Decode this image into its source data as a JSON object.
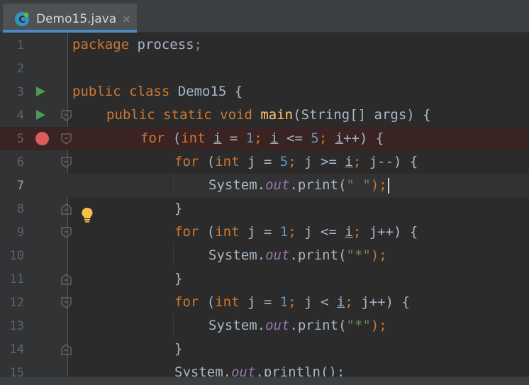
{
  "tab": {
    "icon": "java-class-icon",
    "label": "Demo15.java",
    "close_glyph": "×"
  },
  "editor": {
    "current_line": 7,
    "breakpoint_line": 5,
    "lines": [
      {
        "n": "1"
      },
      {
        "n": "2"
      },
      {
        "n": "3"
      },
      {
        "n": "4"
      },
      {
        "n": "5"
      },
      {
        "n": "6"
      },
      {
        "n": "7"
      },
      {
        "n": "8"
      },
      {
        "n": "9"
      },
      {
        "n": "10"
      },
      {
        "n": "11"
      },
      {
        "n": "12"
      },
      {
        "n": "13"
      },
      {
        "n": "14"
      },
      {
        "n": "15"
      }
    ],
    "code": {
      "l1_kw": "package",
      "l1_rest": " process",
      "l1_semi": ";",
      "l3_kw": "public class",
      "l3_rest": " Demo15 {",
      "l4_kw": "public static void",
      "l4_fn": "main",
      "l4_rest": "(String[] args) {",
      "for": "for",
      "int": "int",
      "i": "i",
      "j": "j",
      "system": "System.",
      "out": "out",
      "print": ".print(",
      "println": ".println();",
      "space_str": "\" \"",
      "star_str": "\"*\"",
      "close_call": ");",
      "close_brace": "}"
    }
  }
}
